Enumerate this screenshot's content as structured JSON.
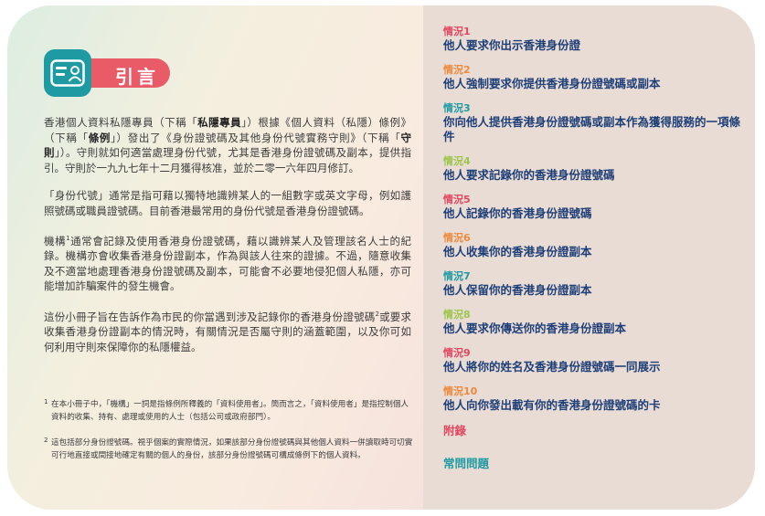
{
  "intro": {
    "heading": "引言",
    "p1_a": "香港個人資料私隱專員（下稱「",
    "p1_b": "私隱專員",
    "p1_c": "」）根據《個人資料（私隱）條例》（下稱「",
    "p1_d": "條例",
    "p1_e": "」）發出了《身份證號碼及其他身份代號實務守則》（下稱「",
    "p1_f": "守則",
    "p1_g": "」）。守則就如何適當處理身份代號，尤其是香港身份證號碼及副本，提供指引。守則於一九九七年十二月獲得核准，並於二零一六年四月修訂。",
    "p2": "「身份代號」通常是指可藉以獨特地識辨某人的一組數字或英文字母，例如護照號碼或職員證號碼。目前香港最常用的身份代號是香港身份證號碼。",
    "p3_a": "機構",
    "p3_sup": "1",
    "p3_b": "通常會記錄及使用香港身份證號碼，藉以識辨某人及管理該名人士的紀錄。機構亦會收集香港身份證副本，作為與該人往來的證據。不過，隨意收集及不適當地處理香港身份證號碼及副本，可能會不必要地侵犯個人私隱，亦可能增加詐騙案件的發生機會。",
    "p4_a": "這份小冊子旨在告訴作為市民的你當遇到涉及記錄你的香港身份證號碼",
    "p4_sup": "2",
    "p4_b": "或要求收集香港身份證副本的情況時，有關情況是否屬守則的涵蓋範圍，以及你可如何利用守則來保障你的私隱權益。",
    "fn1_num": "1",
    "fn1": "在本小冊子中，「機構」一詞是指條例所釋義的「資料使用者」。簡而言之，「資料使用者」是指控制個人資料的收集、持有、處理或使用的人士（包括公司或政府部門）。",
    "fn2_num": "2",
    "fn2": "這包括部分身份證號碼。視乎個案的實際情況，如果該部分身份證號碼與其他個人資料一併讀取時可切實可行地直接或間接地確定有關的個人的身份，該部分身份證號碼可構成條例下的個人資料。"
  },
  "situations": [
    {
      "tag": "情況1",
      "title": "他人要求你出示香港身份證",
      "color": "#e2475f"
    },
    {
      "tag": "情況2",
      "title": "他人強制要求你提供香港身份證號碼或副本",
      "color": "#ef8a3c"
    },
    {
      "tag": "情況3",
      "title": "你向他人提供香港身份證號碼或副本作為獲得服務的一項條件",
      "color": "#1e9aa2"
    },
    {
      "tag": "情況4",
      "title": "他人要求記錄你的香港身份證號碼",
      "color": "#9dc54a"
    },
    {
      "tag": "情況5",
      "title": "他人記錄你的香港身份證號碼",
      "color": "#e2475f"
    },
    {
      "tag": "情況6",
      "title": "他人收集你的香港身份證副本",
      "color": "#ef8a3c"
    },
    {
      "tag": "情況7",
      "title": "他人保留你的香港身份證副本",
      "color": "#1e9aa2"
    },
    {
      "tag": "情況8",
      "title": "他人要求你傳送你的香港身份證副本",
      "color": "#9dc54a"
    },
    {
      "tag": "情況9",
      "title": "他人將你的姓名及香港身份證號碼一同展示",
      "color": "#e2475f"
    },
    {
      "tag": "情況10",
      "title": "他人向你發出載有你的香港身份證號碼的卡",
      "color": "#ef8a3c"
    }
  ],
  "appendix": {
    "label": "附錄",
    "color": "#e2475f"
  },
  "faq": {
    "label": "常問問題",
    "color": "#1e9aa2"
  },
  "colors": {
    "title_blue": "#1f3f78",
    "accent_red": "#ea5b68",
    "icon_teal": "#1e9aa2"
  }
}
